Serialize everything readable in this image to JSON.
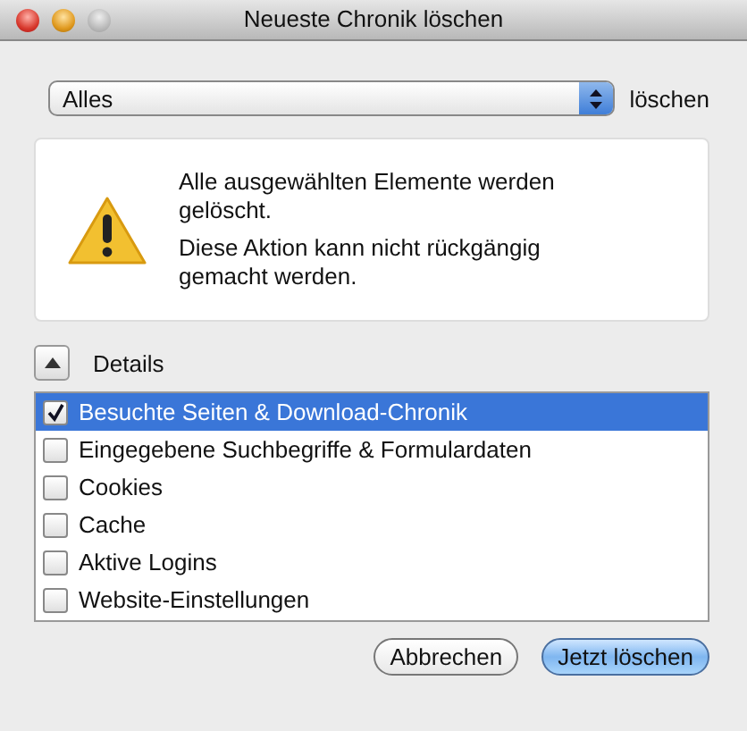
{
  "window": {
    "title": "Neueste Chronik löschen"
  },
  "range": {
    "value": "Alles",
    "label": "löschen"
  },
  "warning": {
    "lines": [
      "Alle ausgewählten Elemente werden gelöscht.",
      "Diese Aktion kann nicht rückgängig gemacht werden."
    ]
  },
  "details": {
    "label": "Details",
    "expanded": true
  },
  "items": [
    {
      "label": "Besuchte Seiten & Download-Chronik",
      "checked": true,
      "selected": true
    },
    {
      "label": "Eingegebene Suchbegriffe & Formulardaten",
      "checked": false,
      "selected": false
    },
    {
      "label": "Cookies",
      "checked": false,
      "selected": false
    },
    {
      "label": "Cache",
      "checked": false,
      "selected": false
    },
    {
      "label": "Aktive Logins",
      "checked": false,
      "selected": false
    },
    {
      "label": "Website-Einstellungen",
      "checked": false,
      "selected": false
    }
  ],
  "buttons": [
    {
      "label": "Abbrechen",
      "kind": "normal"
    },
    {
      "label": "Jetzt löschen",
      "kind": "default"
    }
  ]
}
